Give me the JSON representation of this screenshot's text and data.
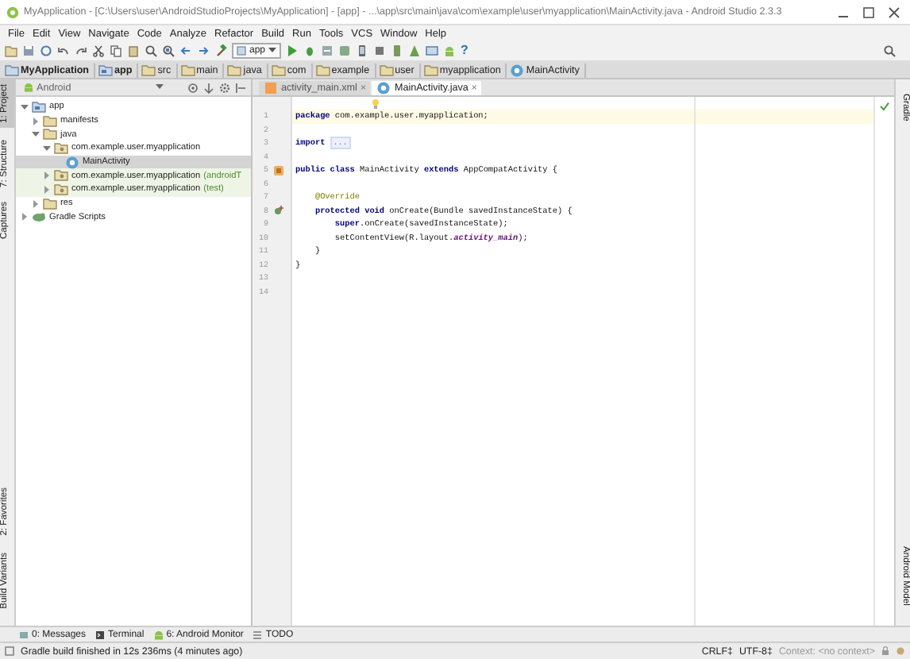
{
  "window": {
    "title": "MyApplication - [C:\\Users\\user\\AndroidStudioProjects\\MyApplication] - [app] - ...\\app\\src\\main\\java\\com\\example\\user\\myapplication\\MainActivity.java - Android Studio 2.3.3"
  },
  "menu": [
    "File",
    "Edit",
    "View",
    "Navigate",
    "Code",
    "Analyze",
    "Refactor",
    "Build",
    "Run",
    "Tools",
    "VCS",
    "Window",
    "Help"
  ],
  "toolbar": {
    "run_config": "app",
    "help": "?"
  },
  "breadcrumbs": [
    {
      "label": "MyApplication",
      "kind": "project"
    },
    {
      "label": "app",
      "kind": "module"
    },
    {
      "label": "src",
      "kind": "folder"
    },
    {
      "label": "main",
      "kind": "folder"
    },
    {
      "label": "java",
      "kind": "folder"
    },
    {
      "label": "com",
      "kind": "folder"
    },
    {
      "label": "example",
      "kind": "folder"
    },
    {
      "label": "user",
      "kind": "folder"
    },
    {
      "label": "myapplication",
      "kind": "folder"
    },
    {
      "label": "MainActivity",
      "kind": "class"
    }
  ],
  "left_stripe": {
    "top": [
      {
        "label": "1: Project",
        "selected": true
      },
      {
        "label": "7: Structure",
        "selected": false
      },
      {
        "label": "Captures",
        "selected": false
      }
    ],
    "bottom": [
      {
        "label": "2: Favorites",
        "selected": false
      },
      {
        "label": "Build Variants",
        "selected": false
      }
    ]
  },
  "project_panel": {
    "view": "Android",
    "tree": [
      {
        "label": "app",
        "kind": "module",
        "expanded": true,
        "selected": false,
        "children": [
          {
            "label": "manifests",
            "kind": "folder",
            "expanded": false,
            "selected": false
          },
          {
            "label": "java",
            "kind": "folder",
            "expanded": true,
            "selected": false,
            "children": [
              {
                "label": "com.example.user.myapplication",
                "kind": "package",
                "expanded": true,
                "selected": false,
                "children": [
                  {
                    "label": "MainActivity",
                    "kind": "class",
                    "selected": true
                  }
                ]
              },
              {
                "label": "com.example.user.myapplication",
                "suffix": "(androidT",
                "kind": "package",
                "expanded": false,
                "selected": false
              },
              {
                "label": "com.example.user.myapplication",
                "suffix": "(test)",
                "kind": "package",
                "expanded": false,
                "selected": false
              }
            ]
          },
          {
            "label": "res",
            "kind": "folder",
            "expanded": false,
            "selected": false
          }
        ]
      },
      {
        "label": "Gradle Scripts",
        "kind": "gradle",
        "expanded": false,
        "selected": false
      }
    ]
  },
  "editor": {
    "tabs": [
      {
        "label": "activity_main.xml",
        "kind": "xml",
        "close": "×",
        "selected": false
      },
      {
        "label": "MainActivity.java",
        "kind": "java",
        "close": "×",
        "selected": true
      }
    ],
    "lines": [
      {
        "number": "1",
        "text": "**package** com.example.user.myapplication;",
        "current": true
      },
      {
        "number": "2",
        "current": false
      },
      {
        "number": "3",
        "text": "**import**",
        "fold": "...",
        "current": false
      },
      {
        "number": "4",
        "current": false
      },
      {
        "number": "5",
        "text": "**public class** MainActivity **extends** AppCompatActivity {",
        "kind": "class",
        "current": false
      },
      {
        "number": "6",
        "current": false
      },
      {
        "number": "7",
        "text": "    @Override",
        "kind": "annotation",
        "current": false
      },
      {
        "number": "8",
        "text": "    **protected void** onCreate(Bundle savedInstanceState) {",
        "kind": "override",
        "current": false
      },
      {
        "number": "9",
        "text": "        **super**.onCreate(savedInstanceState);",
        "current": false
      },
      {
        "number": "10",
        "text": "        setContentView(R.layout.*activity_main*);",
        "current": false
      },
      {
        "number": "11",
        "text": "    }",
        "current": false
      },
      {
        "number": "12",
        "text": "}",
        "current": false
      },
      {
        "number": "13",
        "current": false
      },
      {
        "number": "14",
        "current": false
      }
    ]
  },
  "right_stripe": {
    "top": [
      "Gradle"
    ],
    "bottom": [
      "Android Model"
    ]
  },
  "tool_tabs": [
    {
      "label": "0: Messages",
      "kind": "messages"
    },
    {
      "label": "Terminal",
      "kind": "terminal"
    },
    {
      "label": "6: Android Monitor",
      "kind": "android"
    },
    {
      "label": "TODO",
      "kind": "todo"
    }
  ],
  "status_bar": {
    "message": "Gradle build finished in 12s 236ms (4 minutes ago)",
    "line_separator": "CRLF‡",
    "encoding": "UTF-8‡",
    "context": "Context: <no context>"
  }
}
